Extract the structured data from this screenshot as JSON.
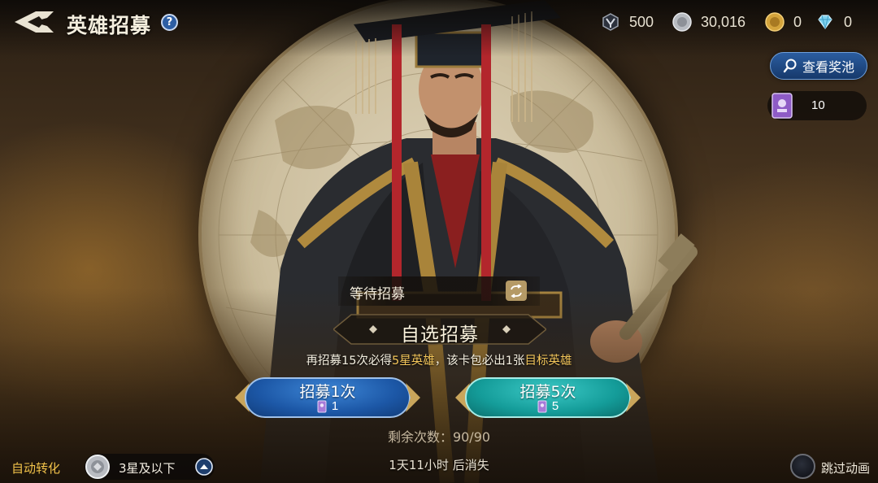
{
  "header": {
    "title": "英雄招募",
    "help_label": "?",
    "resources": [
      {
        "icon": "crest-token-icon",
        "value": "500"
      },
      {
        "icon": "silver-coin-icon",
        "value": "30,016"
      },
      {
        "icon": "gold-coin-icon",
        "value": "0"
      },
      {
        "icon": "diamond-icon",
        "value": "0"
      }
    ]
  },
  "pool_button": {
    "label": "查看奖池",
    "icon": "search-icon"
  },
  "ticket": {
    "icon": "recruit-ticket-icon",
    "count": "10"
  },
  "recruit_panel": {
    "waiting_label": "等待招募",
    "mode_title": "自选招募",
    "guarantee": {
      "part1": "再招募15次必得",
      "highlight1": "5星英雄",
      "part2": "，该卡包必出1张",
      "highlight2": "目标英雄"
    },
    "buttons": [
      {
        "label": "招募1次",
        "cost": "1",
        "color": "#1c57a6"
      },
      {
        "label": "招募5次",
        "cost": "5",
        "color": "#149c99"
      }
    ],
    "remaining": "剩余次数：90/90",
    "expire": "1天11小时 后消失"
  },
  "auto_convert": {
    "label": "自动转化",
    "value": "3星及以下"
  },
  "skip_animation": {
    "label": "跳过动画"
  },
  "colors": {
    "accent_gold": "#f2c55a",
    "auto_label": "#f1c24a",
    "pool_button": "#2b5da0"
  }
}
